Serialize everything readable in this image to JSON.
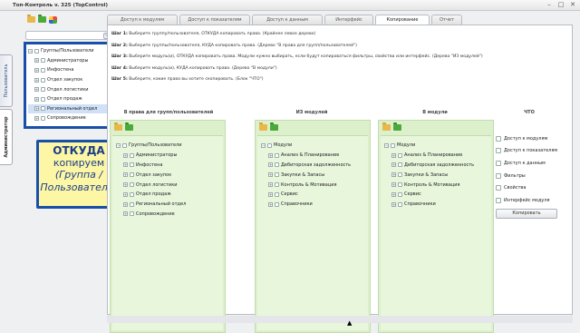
{
  "window": {
    "title": "Топ-Контроль v. 325 (TopControl)",
    "controls": [
      "–",
      "□",
      "✕"
    ]
  },
  "vertical_tabs": [
    {
      "label": "Пользователь",
      "active": false
    },
    {
      "label": "Администратор",
      "active": true
    }
  ],
  "left": {
    "search_placeholder": "",
    "tree": {
      "root": "Группы/Пользователи",
      "items": [
        "Администраторы",
        "Инфостена",
        "Отдел закупок",
        "Отдел логистики",
        "Отдел продаж",
        "Региональный отдел",
        "Сопровождение"
      ],
      "selected_index": 5
    },
    "callout": {
      "line1": "ОТКУДА",
      "line2": "копируем",
      "line3": "(Группа /",
      "line4": "Пользователь)"
    }
  },
  "tabs": [
    {
      "label": "Доступ к модулям",
      "active": false
    },
    {
      "label": "Доступ к показателям",
      "active": false
    },
    {
      "label": "Доступ к данным",
      "active": false
    },
    {
      "label": "Интерфейс",
      "active": false
    },
    {
      "label": "Копирование",
      "active": true
    },
    {
      "label": "Отчет",
      "active": false
    }
  ],
  "steps": [
    {
      "label": "Шаг 1:",
      "text": "Выберите группу/пользователя, ОТКУДА копировать права. (Крайнее левое дерево)"
    },
    {
      "label": "Шаг 2:",
      "text": "Выберите группы/пользователя, КУДА копировать права. (Дерево \"В права для групп/пользователей\")"
    },
    {
      "label": "Шаг 3:",
      "text": "Выберите модуль(и), ОТКУДА копировать права. Модули нужно выбирать, если будут копироваться фильтры, свойства или интерфейс. (Дерево \"ИЗ модулей\")"
    },
    {
      "label": "Шаг 4:",
      "text": "Выберите модуль(и), КУДА копировать права. (Дерево \"В модули\")"
    },
    {
      "label": "Шаг 5:",
      "text": "Выберите, какие права вы хотите скопировать. (Блок \"ЧТО\")"
    }
  ],
  "columns": {
    "to_groups": {
      "header": "В права для групп/пользователей",
      "root": "Группы/Пользователи",
      "items": [
        "Администраторы",
        "Инфостена",
        "Отдел закупок",
        "Отдел логистики",
        "Отдел продаж",
        "Региональный отдел",
        "Сопровождение"
      ]
    },
    "from_modules": {
      "header": "ИЗ модулей",
      "root": "Модули",
      "items": [
        "Анализ & Планирование",
        "Дебиторская задолженность",
        "Закупки & Запасы",
        "Контроль & Мотивация",
        "Сервис",
        "Справочники"
      ]
    },
    "to_modules": {
      "header": "В модули",
      "root": "Модули",
      "items": [
        "Анализ & Планирование",
        "Дебиторская задолженность",
        "Закупки & Запасы",
        "Контроль & Мотивация",
        "Сервис",
        "Справочники"
      ]
    },
    "what": {
      "header": "ЧТО",
      "options": [
        "Доступ к модулям",
        "Доступ к показателям",
        "Доступ к данным",
        "Фильтры",
        "Свойства",
        "Интерфейс модуля"
      ],
      "copy_button": "Копировать"
    }
  },
  "icons": {
    "search": "🔍",
    "expand": "+",
    "collapse": "−"
  }
}
